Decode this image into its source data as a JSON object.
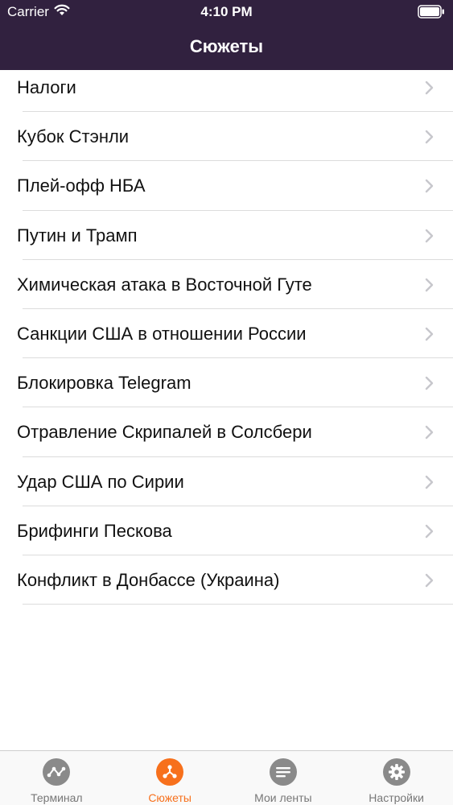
{
  "status_bar": {
    "carrier": "Carrier",
    "time": "4:10 PM"
  },
  "nav": {
    "title": "Сюжеты"
  },
  "topics": [
    {
      "label": "Налоги"
    },
    {
      "label": "Кубок Стэнли"
    },
    {
      "label": "Плей-офф НБА"
    },
    {
      "label": "Путин и Трамп"
    },
    {
      "label": "Химическая атака в Восточной Гуте"
    },
    {
      "label": "Санкции США в отношении России"
    },
    {
      "label": "Блокировка Telegram"
    },
    {
      "label": "Отравление Скрипалей в Солсбери"
    },
    {
      "label": "Удар США по Сирии"
    },
    {
      "label": "Брифинги Пескова"
    },
    {
      "label": "Конфликт в Донбассе (Украина)"
    }
  ],
  "tabbar": {
    "tabs": [
      {
        "label": "Терминал",
        "icon": "graph-icon",
        "active": false
      },
      {
        "label": "Сюжеты",
        "icon": "branch-icon",
        "active": true
      },
      {
        "label": "Мои ленты",
        "icon": "list-icon",
        "active": false
      },
      {
        "label": "Настройки",
        "icon": "gear-icon",
        "active": false
      }
    ]
  },
  "colors": {
    "nav_background": "#31213f",
    "accent": "#f7701c",
    "inactive_icon": "#8a8a8a",
    "separator": "#dcdcdc"
  }
}
